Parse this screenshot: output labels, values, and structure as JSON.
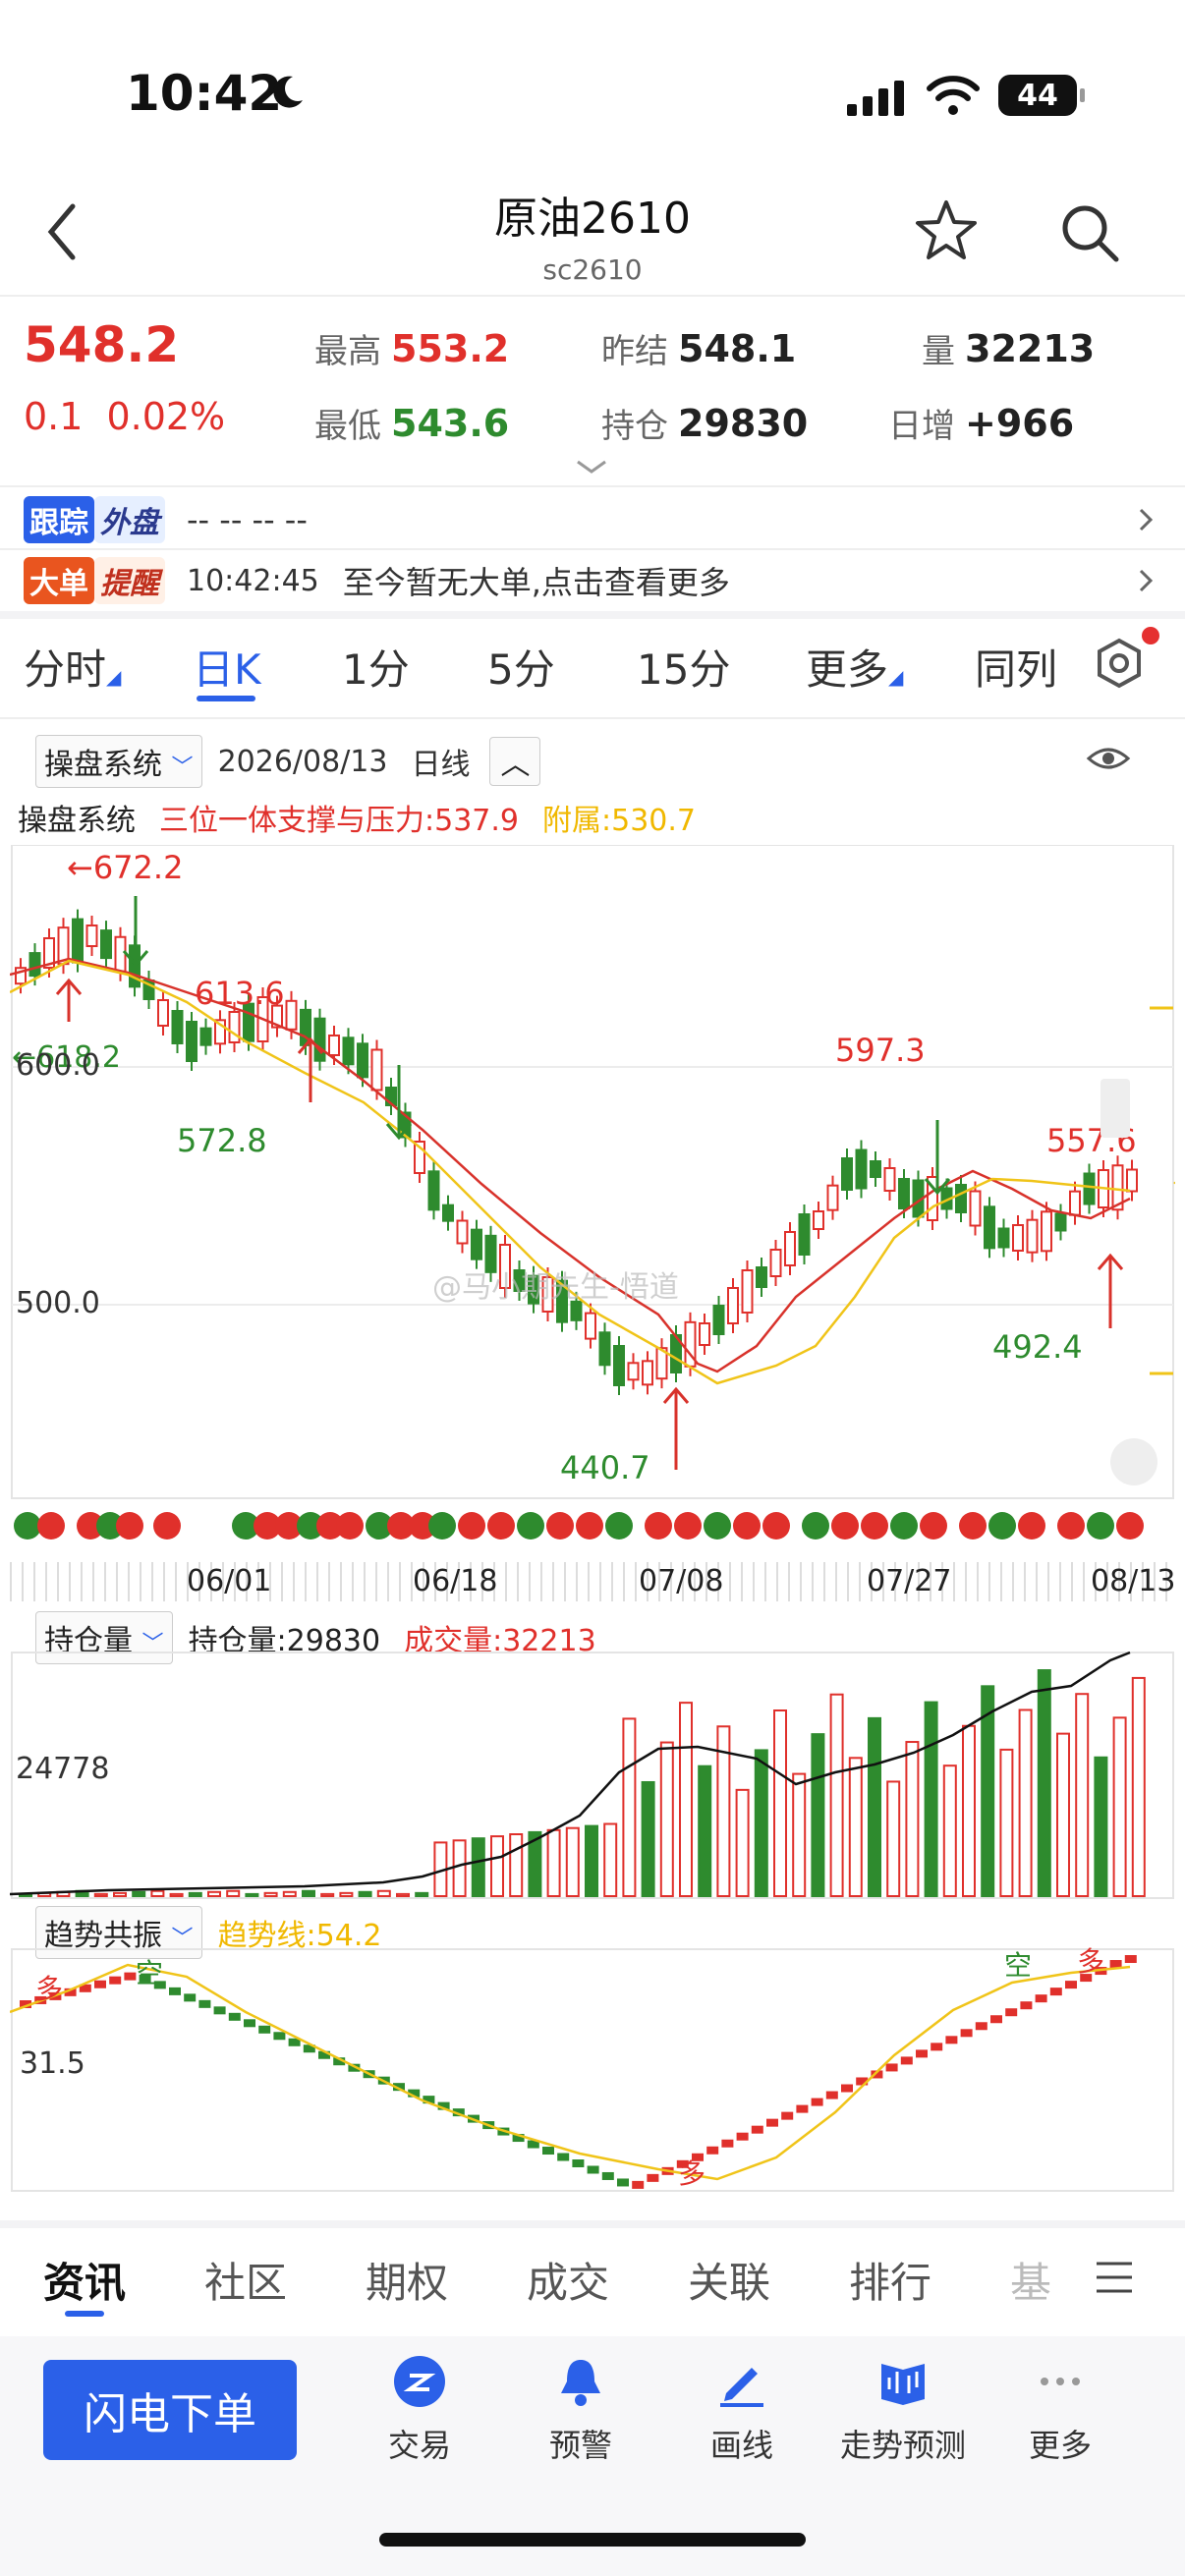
{
  "status": {
    "time": "10:42",
    "battery": "44"
  },
  "header": {
    "title": "原油2610",
    "subtitle": "sc2610"
  },
  "quote": {
    "price": "548.2",
    "change": "0.1",
    "change_pct": "0.02%",
    "high_label": "最高",
    "high": "553.2",
    "low_label": "最低",
    "low": "543.6",
    "prev_settle_label": "昨结",
    "prev_settle": "548.1",
    "open_interest_label": "持仓",
    "open_interest": "29830",
    "volume_label": "量",
    "volume": "32213",
    "daily_inc_label": "日增",
    "daily_inc": "+966"
  },
  "tracking": {
    "tag1": "跟踪",
    "tag2": "外盘",
    "value": "-- -- -- --"
  },
  "bigorder": {
    "tag1": "大单",
    "tag2": "提醒",
    "time": "10:42:45",
    "text": "至今暂无大单,点击查看更多"
  },
  "tabs": [
    "分时",
    "日K",
    "1分",
    "5分",
    "15分",
    "更多",
    "同列"
  ],
  "chart_header": {
    "system": "操盘系统",
    "date": "2026/08/13",
    "period": "日线"
  },
  "indicator": {
    "name": "操盘系统",
    "line1": "三位一体支撑与压力:537.9",
    "line2": "附属:530.7"
  },
  "chart_labels": {
    "price_labels": [
      "←672.2",
      "613.6",
      "572.8",
      "←618.2",
      "440.7",
      "597.3",
      "557.6",
      "492.4"
    ],
    "y_ticks": [
      "600.0",
      "500.0"
    ],
    "x_ticks": [
      "06/01",
      "06/18",
      "07/08",
      "07/27",
      "08/13"
    ],
    "watermark": "@马小期先生-悟道"
  },
  "oi_panel": {
    "selector": "持仓量",
    "oi": "持仓量:29830",
    "vol": "成交量:32213",
    "y_tick": "24778"
  },
  "trend_panel": {
    "selector": "趋势共振",
    "line": "趋势线:54.2",
    "y_tick": "31.5",
    "marks": [
      "多",
      "空",
      "多",
      "空",
      "多"
    ]
  },
  "bottom_tabs": [
    "资讯",
    "社区",
    "期权",
    "成交",
    "关联",
    "排行",
    "基"
  ],
  "toolbar": {
    "flash": "闪电下单",
    "items": [
      "交易",
      "预警",
      "画线",
      "走势预测",
      "更多"
    ]
  },
  "colors": {
    "up": "#e0302b",
    "down": "#2e8b2e",
    "accent": "#2b60e8",
    "ma": "#f0c419"
  },
  "chart_data": {
    "type": "candlestick",
    "x_ticks": [
      "06/01",
      "06/18",
      "07/08",
      "07/27",
      "08/13"
    ],
    "y_ticks": [
      600.0,
      500.0
    ],
    "annotations": [
      {
        "label": "672.2",
        "kind": "high"
      },
      {
        "label": "618.2",
        "kind": "low"
      },
      {
        "label": "613.6",
        "kind": "high"
      },
      {
        "label": "572.8",
        "kind": "low"
      },
      {
        "label": "440.7",
        "kind": "low"
      },
      {
        "label": "597.3",
        "kind": "high"
      },
      {
        "label": "492.4",
        "kind": "low"
      },
      {
        "label": "557.6",
        "kind": "high"
      }
    ]
  }
}
